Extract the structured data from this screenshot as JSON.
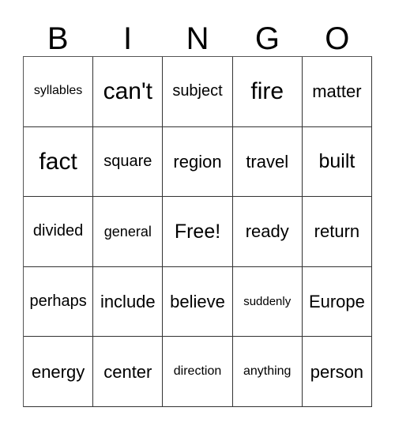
{
  "header": {
    "letters": [
      "B",
      "I",
      "N",
      "G",
      "O"
    ]
  },
  "grid": {
    "rows": [
      [
        {
          "text": "syllables",
          "size": "fs-xs"
        },
        {
          "text": "can't",
          "size": "fs-xxl"
        },
        {
          "text": "subject",
          "size": "fs-m"
        },
        {
          "text": "fire",
          "size": "fs-xxl"
        },
        {
          "text": "matter",
          "size": "fs-l"
        }
      ],
      [
        {
          "text": "fact",
          "size": "fs-xxl"
        },
        {
          "text": "square",
          "size": "fs-m"
        },
        {
          "text": "region",
          "size": "fs-l"
        },
        {
          "text": "travel",
          "size": "fs-l"
        },
        {
          "text": "built",
          "size": "fs-xl"
        }
      ],
      [
        {
          "text": "divided",
          "size": "fs-m"
        },
        {
          "text": "general",
          "size": "fs-s"
        },
        {
          "text": "Free!",
          "size": "fs-xl"
        },
        {
          "text": "ready",
          "size": "fs-l"
        },
        {
          "text": "return",
          "size": "fs-l"
        }
      ],
      [
        {
          "text": "perhaps",
          "size": "fs-m"
        },
        {
          "text": "include",
          "size": "fs-l"
        },
        {
          "text": "believe",
          "size": "fs-l"
        },
        {
          "text": "suddenly",
          "size": "fs-xxs"
        },
        {
          "text": "Europe",
          "size": "fs-l"
        }
      ],
      [
        {
          "text": "energy",
          "size": "fs-l"
        },
        {
          "text": "center",
          "size": "fs-l"
        },
        {
          "text": "direction",
          "size": "fs-xs"
        },
        {
          "text": "anything",
          "size": "fs-xs"
        },
        {
          "text": "person",
          "size": "fs-l"
        }
      ]
    ]
  },
  "colors": {
    "background": "#ffffff",
    "text": "#000000",
    "grid_line": "#333333",
    "outer_border": "#555555"
  }
}
